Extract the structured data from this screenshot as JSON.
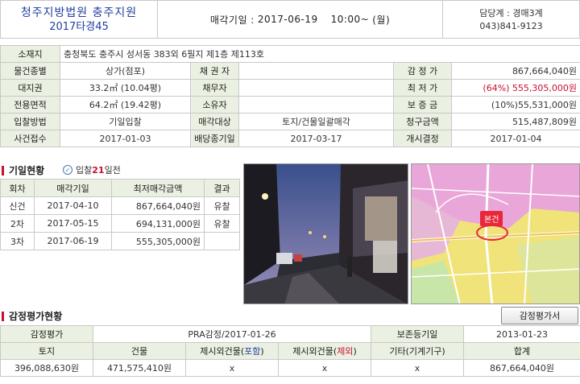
{
  "header": {
    "court": "청주지방법원 충주지원",
    "case_no": "2017타경45",
    "date_label": "매각기일 :",
    "date": "2017-06-19",
    "time": "10:00~",
    "weekday": "(월)",
    "dept": "담당계 : 경매3계",
    "phone": "043)841-9123"
  },
  "info": {
    "address_label": "소재지",
    "address": "충청북도 충주시 성서동 383외 6필지 제1층 제113호",
    "type_label": "물건종별",
    "type": "상가(점포)",
    "creditor_label": "채 권 자",
    "creditor": "",
    "appraisal_label": "감 정 가",
    "appraisal": "867,664,040원",
    "land_right_label": "대지권",
    "land_right": "33.2㎡ (10.04평)",
    "debtor_label": "채무자",
    "debtor": "",
    "min_price_label": "최 저 가",
    "min_price": "(64%) 555,305,000원",
    "area_label": "전용면적",
    "area": "64.2㎡ (19.42평)",
    "owner_label": "소유자",
    "owner": "",
    "deposit_label": "보 증 금",
    "deposit": "(10%)55,531,000원",
    "bid_method_label": "입찰방법",
    "bid_method": "기일입찰",
    "sale_target_label": "매각대상",
    "sale_target": "토지/건물일괄매각",
    "claim_label": "청구금액",
    "claim": "515,487,809원",
    "receipt_label": "사건접수",
    "receipt": "2017-01-03",
    "dividend_label": "배당종기일",
    "dividend": "2017-03-17",
    "start_label": "개시결정",
    "start": "2017-01-04"
  },
  "history": {
    "title": "기일현황",
    "note_prefix": "입찰",
    "note_days": "21",
    "note_suffix": "일전",
    "headers": [
      "회차",
      "매각기일",
      "최저매각금액",
      "결과"
    ],
    "rows": [
      {
        "round": "신건",
        "date": "2017-04-10",
        "price": "867,664,040원",
        "result": "유찰"
      },
      {
        "round": "2차",
        "date": "2017-05-15",
        "price": "694,131,000원",
        "result": "유찰"
      },
      {
        "round": "3차",
        "date": "2017-06-19",
        "price": "555,305,000원",
        "result": ""
      }
    ]
  },
  "map": {
    "marker": "본건"
  },
  "appraisal_section": {
    "title": "감정평가현황",
    "button": "감정평가서",
    "appraisal_label": "감정평가",
    "appraisal_value": "PRA감정/2017-01-26",
    "preserve_label": "보존등기일",
    "preserve_value": "2013-01-23",
    "headers": {
      "land": "토지",
      "building": "건물",
      "excl_pre": "제시외건물(",
      "excl_incl": "포함",
      "excl_excl": "제외",
      "excl_post": ")",
      "other": "기타(기계기구)",
      "total": "합계"
    },
    "values": {
      "land": "396,088,630원",
      "building": "471,575,410원",
      "incl": "x",
      "excl": "x",
      "other": "x",
      "total": "867,664,040원"
    }
  },
  "colors": {
    "label_bg": "#eaf0e2",
    "court_blue": "#1f3f9e",
    "accent_red": "#c8102e",
    "map_marker": "#e8283a"
  }
}
